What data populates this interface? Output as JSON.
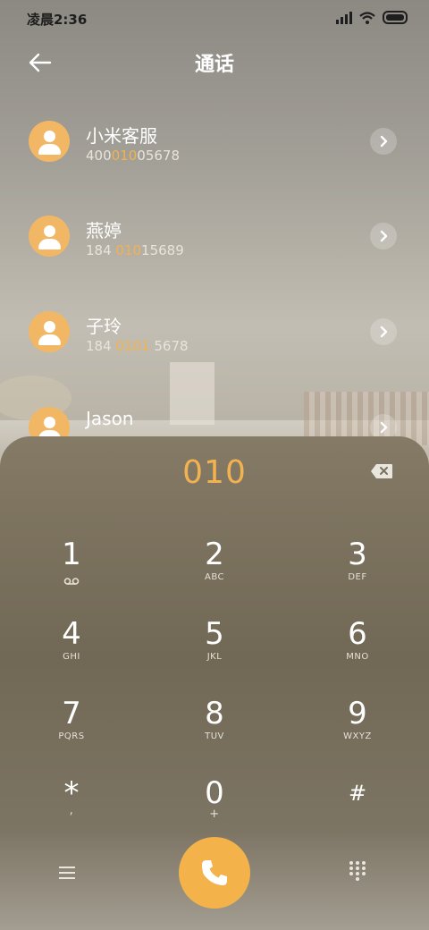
{
  "status_bar": {
    "time": "凌晨2:36",
    "icons": [
      "signal-icon",
      "wifi-icon",
      "battery-icon"
    ]
  },
  "header": {
    "title": "通话",
    "back_icon": "arrow-left-icon"
  },
  "contacts": [
    {
      "name": "小米客服",
      "number_pre": "400",
      "number_match": "010",
      "number_post": "05678"
    },
    {
      "name": "燕婷",
      "number_pre": "184 ",
      "number_match": "010",
      "number_post": "15689"
    },
    {
      "name": "子玲",
      "number_pre": "184 ",
      "number_match": "0101",
      "number_post": " 5678"
    },
    {
      "name": "Jason",
      "number_pre": "",
      "number_match": "",
      "number_post": ""
    }
  ],
  "dialer": {
    "input_value": "010",
    "keys": [
      {
        "digit": "1",
        "sub": "voicemail-icon"
      },
      {
        "digit": "2",
        "sub": "ABC"
      },
      {
        "digit": "3",
        "sub": "DEF"
      },
      {
        "digit": "4",
        "sub": "GHI"
      },
      {
        "digit": "5",
        "sub": "JKL"
      },
      {
        "digit": "6",
        "sub": "MNO"
      },
      {
        "digit": "7",
        "sub": "PQRS"
      },
      {
        "digit": "8",
        "sub": "TUV"
      },
      {
        "digit": "9",
        "sub": "WXYZ"
      },
      {
        "digit": "*",
        "sub": ","
      },
      {
        "digit": "0",
        "sub": "+"
      },
      {
        "digit": "#",
        "sub": ""
      }
    ]
  },
  "colors": {
    "accent": "#f2b24f",
    "avatar": "#f2b765",
    "call_button": "#f4b24a"
  }
}
